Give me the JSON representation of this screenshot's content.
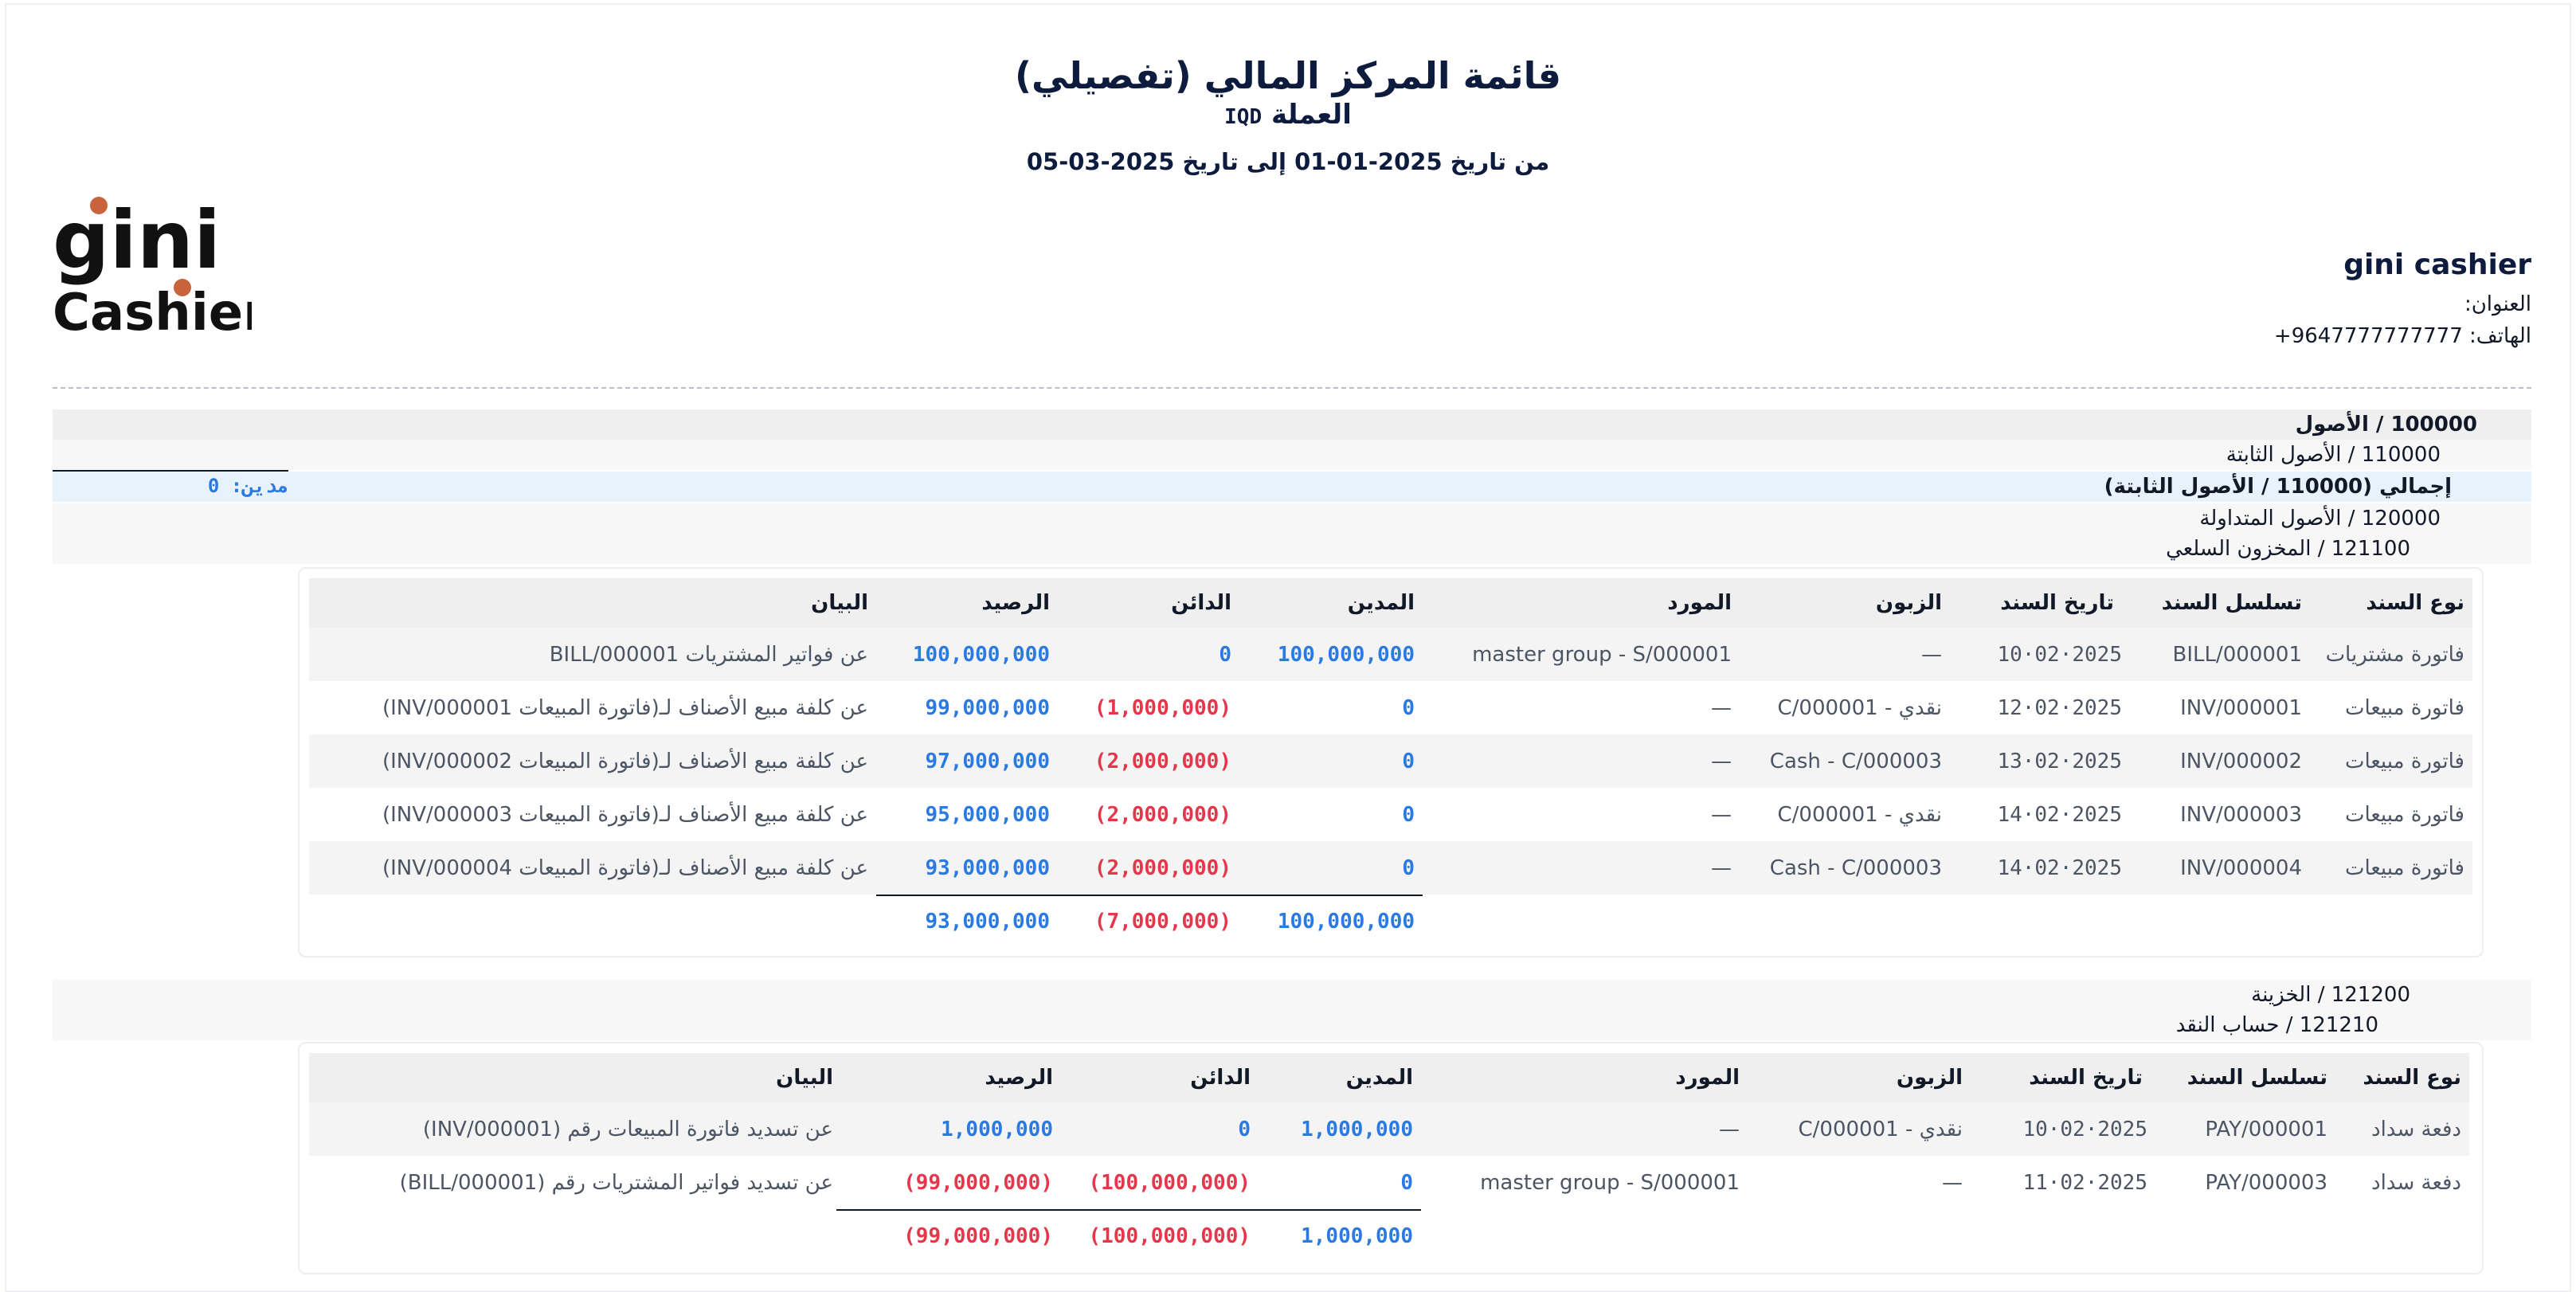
{
  "report": {
    "title": "قائمة المركز المالي (تفصيلي)",
    "currency_label": "العملة",
    "currency_code": "IQD",
    "date_range": "من تاريخ 2025-01-01 إلى تاريخ 2025-03-05"
  },
  "logo": {
    "line1": "gini",
    "line2": "Cashier",
    "accent_color": "#c8643c"
  },
  "company": {
    "name": "gini cashier",
    "address_label": "العنوان:",
    "phone_label": "الهاتف:",
    "phone": "+9647777777777"
  },
  "accounts": {
    "assets": "100000 / الأصول",
    "fixed_assets": "110000 / الأصول الثابتة",
    "fixed_assets_total": "إجمالي (110000 / الأصول الثابتة)",
    "fixed_assets_total_value": "مدين: 0",
    "current_assets": "120000 / الأصول المتداولة",
    "inventory": "121100 / المخزون السلعي",
    "treasury": "121200 / الخزينة",
    "cash_account": "121210 / حساب النقد"
  },
  "table_headers": {
    "type": "نوع السند",
    "serial": "تسلسل السند",
    "date": "تاريخ السند",
    "customer": "الزبون",
    "supplier": "المورد",
    "debit": "المدين",
    "credit": "الدائن",
    "balance": "الرصيد",
    "description": "البيان"
  },
  "inventory_table": {
    "rows": [
      {
        "type": "فاتورة مشتريات",
        "serial": "BILL/000001",
        "date": "2025·02·10",
        "customer": "—",
        "supplier": "master group - S/000001",
        "debit": "100,000,000",
        "credit": "0",
        "balance": "100,000,000",
        "description": "عن فواتير المشتريات BILL/000001"
      },
      {
        "type": "فاتورة مبيعات",
        "serial": "INV/000001",
        "date": "2025·02·12",
        "customer": "نقدي - C/000001",
        "supplier": "—",
        "debit": "0",
        "credit": "(1,000,000)",
        "balance": "99,000,000",
        "description": "عن كلفة مبيع الأصناف لـ(فاتورة المبيعات INV/000001)"
      },
      {
        "type": "فاتورة مبيعات",
        "serial": "INV/000002",
        "date": "2025·02·13",
        "customer": "Cash - C/000003",
        "supplier": "—",
        "debit": "0",
        "credit": "(2,000,000)",
        "balance": "97,000,000",
        "description": "عن كلفة مبيع الأصناف لـ(فاتورة المبيعات INV/000002)"
      },
      {
        "type": "فاتورة مبيعات",
        "serial": "INV/000003",
        "date": "2025·02·14",
        "customer": "نقدي - C/000001",
        "supplier": "—",
        "debit": "0",
        "credit": "(2,000,000)",
        "balance": "95,000,000",
        "description": "عن كلفة مبيع الأصناف لـ(فاتورة المبيعات INV/000003)"
      },
      {
        "type": "فاتورة مبيعات",
        "serial": "INV/000004",
        "date": "2025·02·14",
        "customer": "Cash - C/000003",
        "supplier": "—",
        "debit": "0",
        "credit": "(2,000,000)",
        "balance": "93,000,000",
        "description": "عن كلفة مبيع الأصناف لـ(فاتورة المبيعات INV/000004)"
      }
    ],
    "totals": {
      "debit": "100,000,000",
      "credit": "(7,000,000)",
      "balance": "93,000,000"
    }
  },
  "cash_table": {
    "rows": [
      {
        "type": "دفعة سداد",
        "serial": "PAY/000001",
        "date": "2025·02·10",
        "customer": "نقدي - C/000001",
        "supplier": "—",
        "debit": "1,000,000",
        "credit": "0",
        "balance": "1,000,000",
        "description": "عن تسديد فاتورة المبيعات رقم (INV/000001)"
      },
      {
        "type": "دفعة سداد",
        "serial": "PAY/000003",
        "date": "2025·02·11",
        "customer": "—",
        "supplier": "master group - S/000001",
        "debit": "0",
        "credit": "(100,000,000)",
        "balance": "(99,000,000)",
        "description": "عن تسديد فواتير المشتريات رقم (BILL/000001)"
      }
    ],
    "totals": {
      "debit": "1,000,000",
      "credit": "(100,000,000)",
      "balance": "(99,000,000)"
    }
  },
  "colors": {
    "positive": "#2a7ae2",
    "negative": "#e5364a",
    "title": "#0d1b3e"
  }
}
